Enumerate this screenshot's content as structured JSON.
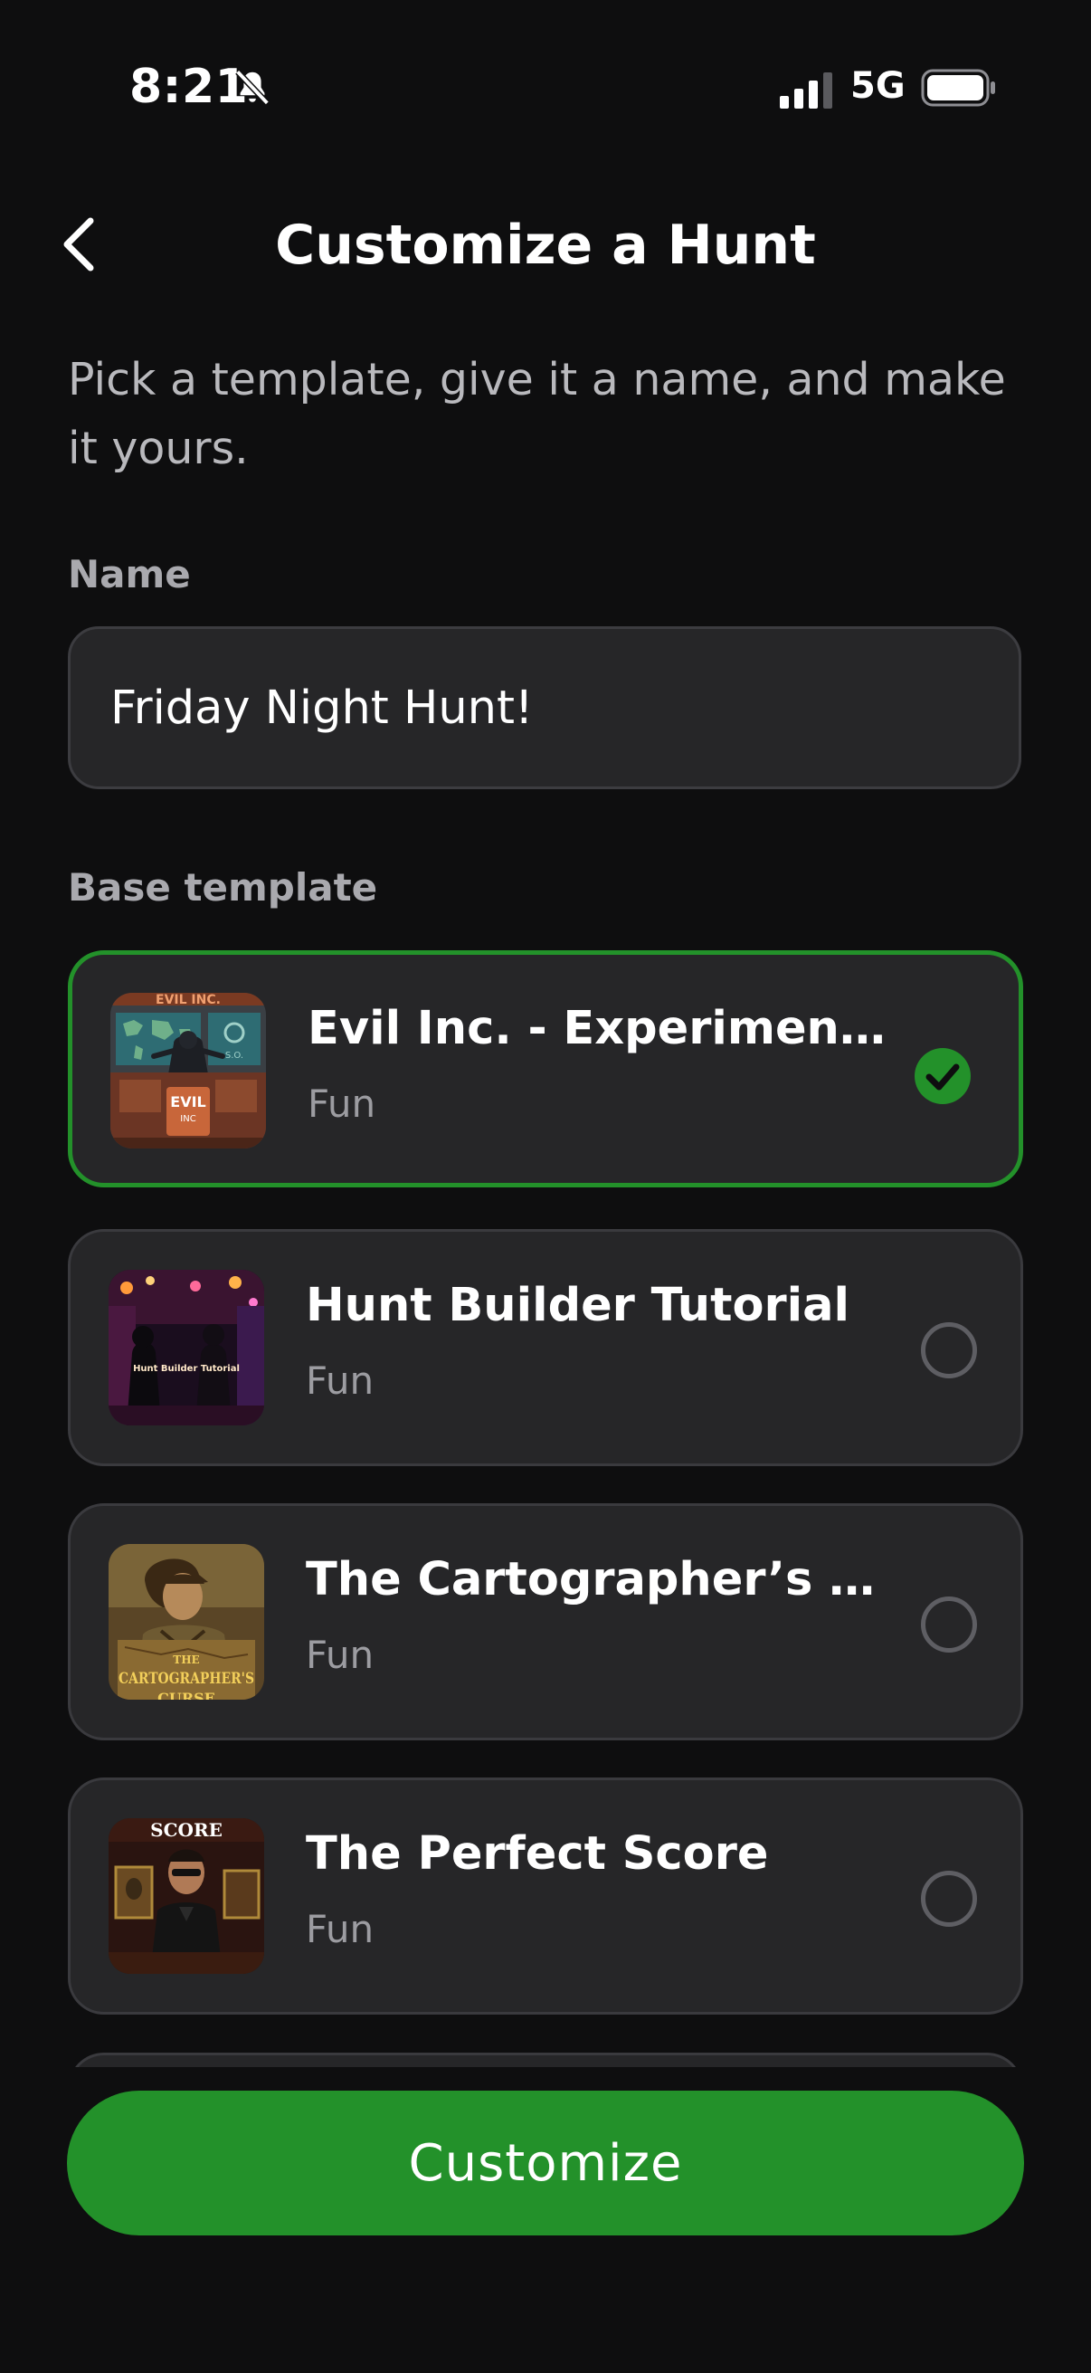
{
  "status_bar": {
    "time": "8:21",
    "network": "5G",
    "icons": [
      "bell-slash-icon",
      "signal-icon",
      "battery-icon"
    ]
  },
  "header": {
    "title": "Customize a Hunt",
    "back_icon": "chevron-left-icon"
  },
  "subtitle": "Pick a template, give it a name, and make it yours.",
  "name_section": {
    "label": "Name",
    "value": "Friday Night Hunt!"
  },
  "template_section": {
    "label": "Base template",
    "templates": [
      {
        "title": "Evil Inc. - Experiment #...",
        "category": "Fun",
        "selected": true
      },
      {
        "title": "Hunt Builder Tutorial",
        "category": "Fun",
        "selected": false
      },
      {
        "title": "The Cartographer’s Curse",
        "category": "Fun",
        "selected": false
      },
      {
        "title": "The Perfect Score",
        "category": "Fun",
        "selected": false
      }
    ]
  },
  "thumbnails": {
    "evil_inc": {
      "top_text": "EVIL INC.",
      "sign_text": "EVIL",
      "sign_sub": "INC"
    },
    "tutorial": {
      "caption": "Hunt Builder Tutorial"
    },
    "cartographer": {
      "line1": "THE",
      "line2": "CARTOGRAPHER'S",
      "line3": "CURSE"
    },
    "perfect_score": {
      "top_text": "SCORE"
    }
  },
  "primary_action": {
    "label": "Customize"
  },
  "colors": {
    "background": "#0e0e0f",
    "card": "#262628",
    "accent": "#23912a",
    "muted_text": "#9c9ca1"
  }
}
